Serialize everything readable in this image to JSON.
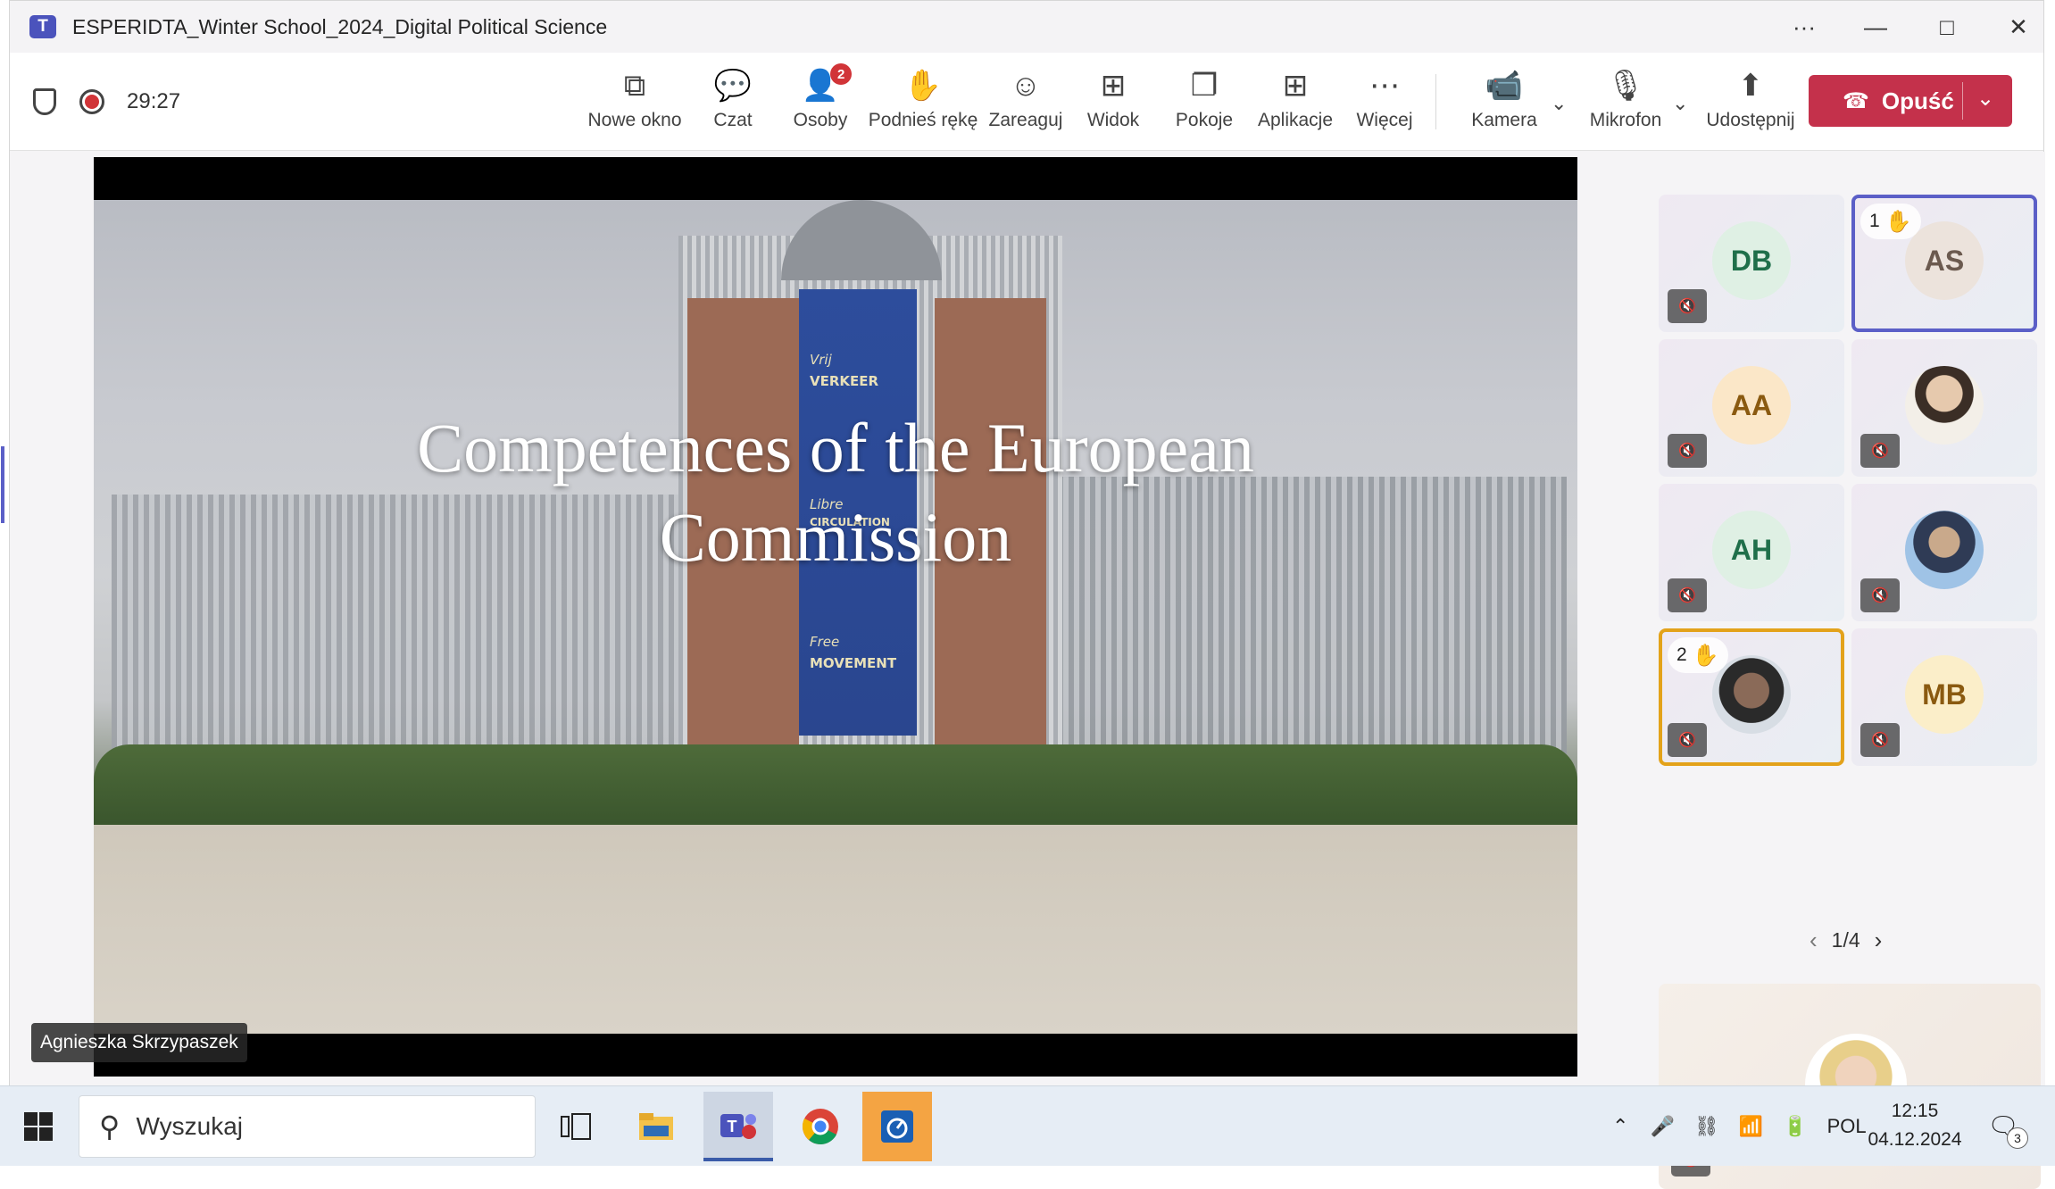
{
  "window": {
    "title": "ESPERIDTA_Winter School_2024_Digital Political Science",
    "app_logo": "T",
    "controls": [
      "more-icon",
      "minimize-icon",
      "maximize-icon",
      "close-icon"
    ]
  },
  "meeting": {
    "timer": "29:27",
    "buttons": [
      {
        "label": "Nowe okno",
        "icon": "new-window-icon"
      },
      {
        "label": "Czat",
        "icon": "chat-icon"
      },
      {
        "label": "Osoby",
        "icon": "people-icon",
        "badge": "2"
      },
      {
        "label": "Podnieś rękę",
        "icon": "raise-hand-icon"
      },
      {
        "label": "Zareaguj",
        "icon": "react-icon"
      },
      {
        "label": "Widok",
        "icon": "view-icon"
      },
      {
        "label": "Pokoje",
        "icon": "rooms-icon"
      },
      {
        "label": "Aplikacje",
        "icon": "apps-icon"
      },
      {
        "label": "Więcej",
        "icon": "more-icon"
      },
      {
        "label": "Kamera",
        "icon": "camera-off-icon"
      },
      {
        "label": "Mikrofon",
        "icon": "mic-off-icon"
      },
      {
        "label": "Udostępnij",
        "icon": "share-icon"
      }
    ],
    "leave_label": "Opuść",
    "accent": "#c4314b"
  },
  "slide": {
    "title_line1": "Competences of the European",
    "title_line2": "Commission",
    "banner_lines": [
      "Vrij",
      "VERKEER",
      "Libre",
      "CIRCULATION",
      "Free",
      "MOVEMENT"
    ],
    "presenter": "Agnieszka Skrzypaszek"
  },
  "participants": [
    {
      "initials": "DB",
      "color": "#1f6f4a",
      "bg": "#dff0e4",
      "muted": true
    },
    {
      "initials": "AS",
      "color": "#6b5a4f",
      "bg": "#ece3dc",
      "muted": false,
      "hand": "1",
      "highlight": "#5b5fc7"
    },
    {
      "initials": "AA",
      "color": "#8a5a10",
      "bg": "#fbe7c8",
      "muted": true
    },
    {
      "initials": "",
      "photo": true,
      "muted": true
    },
    {
      "initials": "AH",
      "color": "#1f6f4a",
      "bg": "#dff0e4",
      "muted": true
    },
    {
      "initials": "",
      "photo": true,
      "muted": true
    },
    {
      "initials": "",
      "photo": true,
      "muted": true,
      "hand": "2",
      "highlight": "#e3a21a"
    },
    {
      "initials": "MB",
      "color": "#8a5a10",
      "bg": "#fbeec9",
      "muted": true
    }
  ],
  "pager": "1/4",
  "taskbar": {
    "search_placeholder": "Wyszukaj",
    "language": "POL",
    "time": "12:15",
    "date": "04.12.2024",
    "notifications": "3"
  }
}
